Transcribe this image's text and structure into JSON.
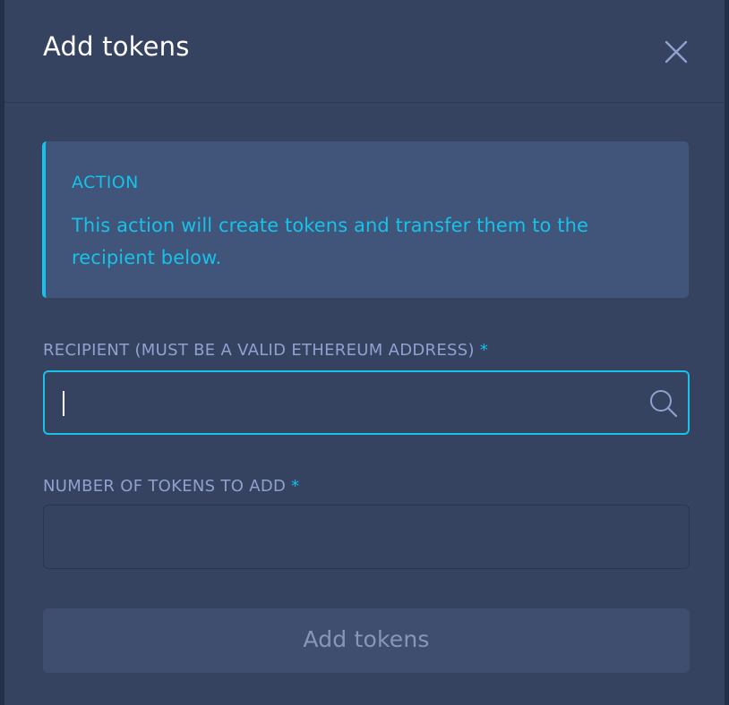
{
  "dialog": {
    "title": "Add tokens",
    "close_icon": "close-icon"
  },
  "info": {
    "title": "ACTION",
    "text": "This action will create tokens and transfer them to the recipient below."
  },
  "recipient": {
    "label": "RECIPIENT (MUST BE A VALID ETHEREUM ADDRESS)",
    "required_mark": "*",
    "value": "",
    "icon": "search-icon"
  },
  "number": {
    "label": "NUMBER OF TOKENS TO ADD",
    "required_mark": "*",
    "value": ""
  },
  "submit": {
    "label": "Add tokens"
  },
  "colors": {
    "panel_bg": "#354260",
    "accent": "#16c2e8",
    "label": "#8fa2cf",
    "info_bg": "#41547a",
    "button_bg": "#3f4e6e",
    "button_text": "#8796b8"
  }
}
